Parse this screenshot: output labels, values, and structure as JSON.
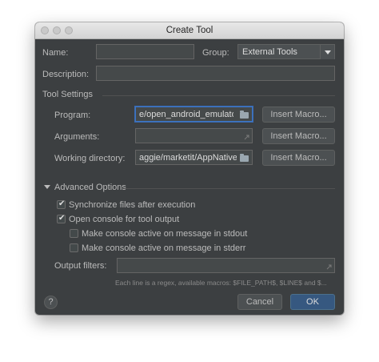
{
  "window": {
    "title": "Create Tool"
  },
  "form": {
    "name_label": "Name:",
    "name_value": "",
    "group_label": "Group:",
    "group_value": "External Tools",
    "description_label": "Description:",
    "description_value": ""
  },
  "tool_settings": {
    "section_label": "Tool Settings",
    "program_label": "Program:",
    "program_value": "e/open_android_emulator",
    "arguments_label": "Arguments:",
    "arguments_value": "",
    "working_dir_label": "Working directory:",
    "working_dir_value": "aggie/marketit/AppNative",
    "insert_macro_label": "Insert Macro..."
  },
  "advanced": {
    "section_label": "Advanced Options",
    "sync_files_label": "Synchronize files after execution",
    "sync_files_checked": true,
    "open_console_label": "Open console for tool output",
    "open_console_checked": true,
    "stdout_label": "Make console active on message in stdout",
    "stdout_checked": false,
    "stderr_label": "Make console active on message in stderr",
    "stderr_checked": false,
    "output_filters_label": "Output filters:",
    "output_filters_value": "",
    "hint": "Each line is a regex, available macros: $FILE_PATH$, $LINE$ and $..."
  },
  "footer": {
    "help_label": "?",
    "cancel_label": "Cancel",
    "ok_label": "OK"
  },
  "colors": {
    "dialog_bg": "#3c3f41",
    "primary_button": "#365880",
    "focus_border": "#3d75c4"
  }
}
